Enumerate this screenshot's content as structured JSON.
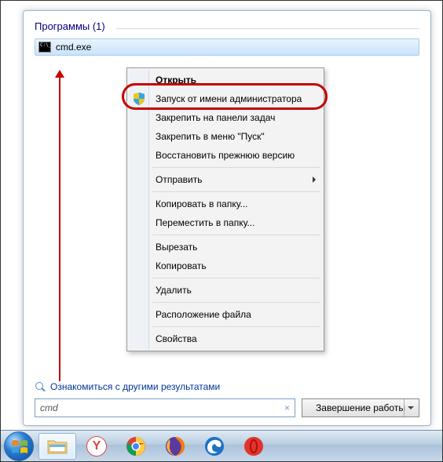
{
  "section": {
    "title": "Программы (1)"
  },
  "result": {
    "label": "cmd.exe"
  },
  "context_menu": {
    "open": "Открыть",
    "run_admin": "Запуск от имени администратора",
    "pin_taskbar": "Закрепить на панели задач",
    "pin_start": "Закрепить в меню \"Пуск\"",
    "restore_prev": "Восстановить прежнюю версию",
    "send_to": "Отправить",
    "copy_to": "Копировать в папку...",
    "move_to": "Переместить в папку...",
    "cut": "Вырезать",
    "copy": "Копировать",
    "delete": "Удалить",
    "file_location": "Расположение файла",
    "properties": "Свойства"
  },
  "other_results": "Ознакомиться с другими результатами",
  "search": {
    "value": "cmd",
    "clear": "×"
  },
  "shutdown": {
    "label": "Завершение работы"
  }
}
